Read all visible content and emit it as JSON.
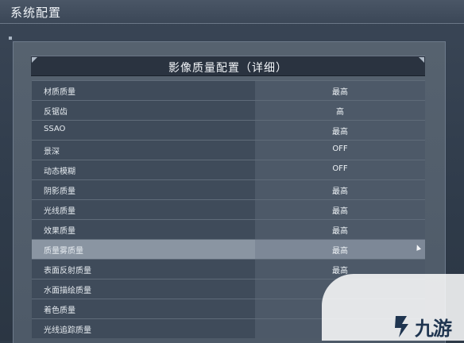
{
  "window": {
    "title": "系统配置"
  },
  "section": {
    "title": "影像质量配置（详细）"
  },
  "settings": [
    {
      "label": "材质质量",
      "value": "最高"
    },
    {
      "label": "反锯齿",
      "value": "高"
    },
    {
      "label": "SSAO",
      "value": "最高"
    },
    {
      "label": "景深",
      "value": "OFF"
    },
    {
      "label": "动态模糊",
      "value": "OFF"
    },
    {
      "label": "阴影质量",
      "value": "最高"
    },
    {
      "label": "光线质量",
      "value": "最高"
    },
    {
      "label": "效果质量",
      "value": "最高"
    },
    {
      "label": "质量雾质量",
      "value": "最高"
    },
    {
      "label": "表面反射质量",
      "value": "最高"
    },
    {
      "label": "水面描绘质量",
      "value": ""
    },
    {
      "label": "着色质量",
      "value": ""
    },
    {
      "label": "光线追踪质量",
      "value": ""
    }
  ],
  "highlighted_row_index": 8,
  "watermark": {
    "text": "九游",
    "icon": "nine-game-logo-icon"
  },
  "colors": {
    "row_label_bg": "#3f4b5a",
    "row_value_bg": "#4d5968",
    "highlight_bg": "#8a95a2",
    "header_bg": "#2a3340"
  }
}
